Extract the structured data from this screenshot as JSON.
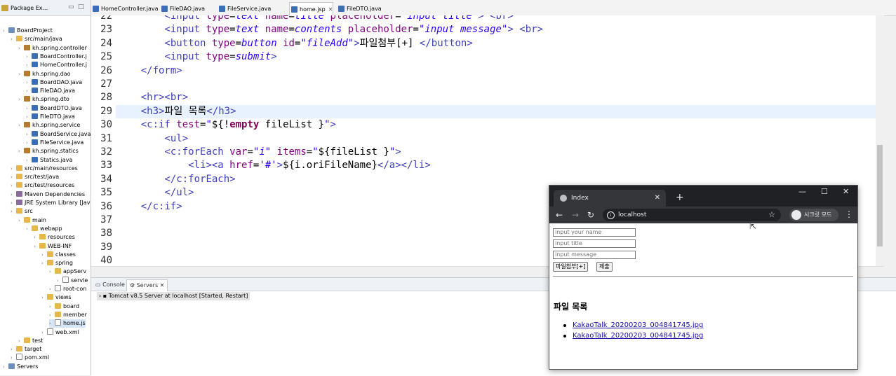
{
  "package_explorer": {
    "tab_label": "Package Ex...",
    "tree": [
      {
        "label": "BoardProject",
        "level": 0,
        "icon": "project"
      },
      {
        "label": "src/main/java",
        "level": 1,
        "icon": "folder"
      },
      {
        "label": "kh.spring.controller",
        "level": 2,
        "icon": "package"
      },
      {
        "label": "BoardController.j",
        "level": 3,
        "icon": "java"
      },
      {
        "label": "HomeController.j",
        "level": 3,
        "icon": "java"
      },
      {
        "label": "kh.spring.dao",
        "level": 2,
        "icon": "package"
      },
      {
        "label": "BoardDAO.java",
        "level": 3,
        "icon": "java"
      },
      {
        "label": "FileDAO.java",
        "level": 3,
        "icon": "java"
      },
      {
        "label": "kh.spring.dto",
        "level": 2,
        "icon": "package"
      },
      {
        "label": "BoardDTO.java",
        "level": 3,
        "icon": "java"
      },
      {
        "label": "FileDTO.java",
        "level": 3,
        "icon": "java"
      },
      {
        "label": "kh.spring.service",
        "level": 2,
        "icon": "package"
      },
      {
        "label": "BoardService.java",
        "level": 3,
        "icon": "java"
      },
      {
        "label": "FileService.java",
        "level": 3,
        "icon": "java"
      },
      {
        "label": "kh.spring.statics",
        "level": 2,
        "icon": "package"
      },
      {
        "label": "Statics.java",
        "level": 3,
        "icon": "java"
      },
      {
        "label": "src/main/resources",
        "level": 1,
        "icon": "folder"
      },
      {
        "label": "src/test/java",
        "level": 1,
        "icon": "folder"
      },
      {
        "label": "src/test/resources",
        "level": 1,
        "icon": "folder"
      },
      {
        "label": "Maven Dependencies",
        "level": 1,
        "icon": "lib"
      },
      {
        "label": "JRE System Library [Jav",
        "level": 1,
        "icon": "lib"
      },
      {
        "label": "src",
        "level": 1,
        "icon": "folder"
      },
      {
        "label": "main",
        "level": 2,
        "icon": "folder"
      },
      {
        "label": "webapp",
        "level": 3,
        "icon": "folder"
      },
      {
        "label": "resources",
        "level": 4,
        "icon": "folder"
      },
      {
        "label": "WEB-INF",
        "level": 4,
        "icon": "folder"
      },
      {
        "label": "classes",
        "level": 5,
        "icon": "folder"
      },
      {
        "label": "spring",
        "level": 5,
        "icon": "folder"
      },
      {
        "label": "appServ",
        "level": 6,
        "icon": "folder"
      },
      {
        "label": "servle",
        "level": 7,
        "icon": "file"
      },
      {
        "label": "root-con",
        "level": 6,
        "icon": "file"
      },
      {
        "label": "views",
        "level": 5,
        "icon": "folder"
      },
      {
        "label": "board",
        "level": 6,
        "icon": "folder"
      },
      {
        "label": "member",
        "level": 6,
        "icon": "folder"
      },
      {
        "label": "home.js",
        "level": 6,
        "icon": "file",
        "selected": true
      },
      {
        "label": "web.xml",
        "level": 5,
        "icon": "file"
      },
      {
        "label": "test",
        "level": 2,
        "icon": "folder"
      },
      {
        "label": "target",
        "level": 1,
        "icon": "folder"
      },
      {
        "label": "pom.xml",
        "level": 1,
        "icon": "file"
      },
      {
        "label": "Servers",
        "level": 0,
        "icon": "project"
      }
    ]
  },
  "editor_tabs": [
    {
      "label": "HomeController.java",
      "active": false
    },
    {
      "label": "FileDAO.java",
      "active": false
    },
    {
      "label": "FileService.java",
      "active": false
    },
    {
      "label": "home.jsp",
      "active": true
    },
    {
      "label": "FileDTO.java",
      "active": false
    }
  ],
  "code_lines": [
    {
      "n": "22",
      "html": "        <span class='t-tag'>&lt;input</span> <span class='t-attr'>type</span>=<span class='t-val'>text</span> <span class='t-attr'>name</span>=<span class='t-val'>title</span> <span class='t-attr'>placeholder</span>=<span class='t-val'>\"input title\"</span><span class='t-tag'>&gt;</span> <span class='t-tag'>&lt;br&gt;</span>"
    },
    {
      "n": "23",
      "html": "        <span class='t-tag'>&lt;input</span> <span class='t-attr'>type</span>=<span class='t-val'>text</span> <span class='t-attr'>name</span>=<span class='t-val'>contents</span> <span class='t-attr'>placeholder</span>=<span class='t-val'>\"input message\"</span><span class='t-tag'>&gt;</span> <span class='t-tag'>&lt;br&gt;</span>"
    },
    {
      "n": "24",
      "html": "        <span class='t-tag'>&lt;button</span> <span class='t-attr'>type</span>=<span class='t-val'>button</span> <span class='t-attr'>id</span>=<span class='t-val'>\"fileAdd\"</span><span class='t-tag'>&gt;</span>파일첨부[+] <span class='t-tag'>&lt;/button&gt;</span>"
    },
    {
      "n": "25",
      "html": "        <span class='t-tag'>&lt;input</span> <span class='t-attr'>type</span>=<span class='t-val'>submit</span><span class='t-tag'>&gt;</span>"
    },
    {
      "n": "26",
      "html": "    <span class='t-tag'>&lt;/form&gt;</span>"
    },
    {
      "n": "27",
      "html": ""
    },
    {
      "n": "28",
      "html": "    <span class='t-tag'>&lt;hr&gt;&lt;br&gt;</span>"
    },
    {
      "n": "29",
      "html": "    <span class='t-tag'>&lt;h3&gt;</span>파일 목록<span class='t-tag'>&lt;/h3&gt;</span>"
    },
    {
      "n": "30",
      "html": "    <span class='t-tag'>&lt;c:if</span> <span class='t-attr'>test</span>=<span class='t-val'>\"</span>${!<span class='t-kw'>empty</span> fileList }<span class='t-val'>\"</span><span class='t-tag'>&gt;</span>"
    },
    {
      "n": "31",
      "html": "        <span class='t-tag'>&lt;ul&gt;</span>"
    },
    {
      "n": "32",
      "html": "        <span class='t-tag'>&lt;c:forEach</span> <span class='t-attr'>var</span>=<span class='t-val'>\"i\"</span> <span class='t-attr'>items</span>=<span class='t-val'>\"</span>${fileList }<span class='t-val'>\"</span><span class='t-tag'>&gt;</span>"
    },
    {
      "n": "33",
      "html": "            <span class='t-tag'>&lt;li&gt;&lt;a</span> <span class='t-attr'>href</span>=<span class='t-val'>'#'</span><span class='t-tag'>&gt;</span>${i.oriFileName}<span class='t-tag'>&lt;/a&gt;&lt;/li&gt;</span>"
    },
    {
      "n": "34",
      "html": "        <span class='t-tag'>&lt;/c:forEach&gt;</span>"
    },
    {
      "n": "35",
      "html": "        <span class='t-tag'>&lt;/ul&gt;</span>"
    },
    {
      "n": "36",
      "html": "    <span class='t-tag'>&lt;/c:if&gt;</span>"
    },
    {
      "n": "37",
      "html": ""
    },
    {
      "n": "38",
      "html": ""
    },
    {
      "n": "39",
      "html": ""
    },
    {
      "n": "40",
      "html": ""
    }
  ],
  "bottom_panel": {
    "tabs": [
      "Console",
      "Servers"
    ],
    "server_row": "Tomcat v8.5 Server at localhost  [Started, Restart]"
  },
  "browser": {
    "tab_title": "Index",
    "url": "localhost",
    "incognito_label": "시크릿 모드",
    "inputs": [
      {
        "placeholder": "input your name"
      },
      {
        "placeholder": "input title"
      },
      {
        "placeholder": "input message"
      }
    ],
    "file_add_button": "파일첨부[+]",
    "submit_button": "제출",
    "heading": "파일 목록",
    "files": [
      "KakaoTalk_20200203_004841745.jpg",
      "KakaoTalk_20200203_004841745.jpg"
    ]
  }
}
